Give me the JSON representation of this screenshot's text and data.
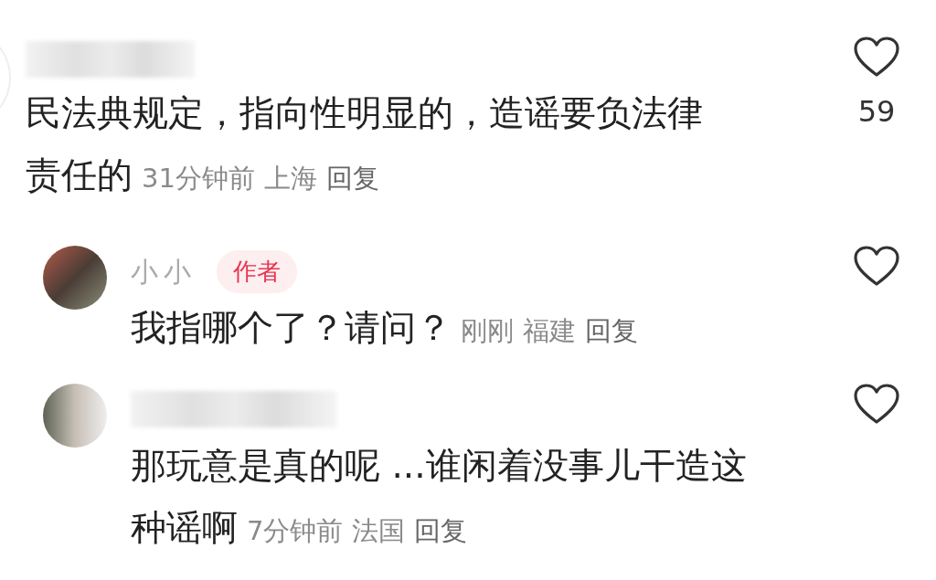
{
  "comments": [
    {
      "text_lines": [
        "民法典规定，指向性明显的，造谣要负法律",
        "责任的"
      ],
      "time": "31分钟前",
      "location": "上海",
      "reply": "回复",
      "likes": "59",
      "replies": [
        {
          "name": "小小",
          "badge": "作者",
          "text_lines": [
            "我指哪个了？请问？"
          ],
          "time": "刚刚",
          "location": "福建",
          "reply": "回复"
        },
        {
          "text_lines": [
            "那玩意是真的呢 ...谁闲着没事儿干造这",
            "种谣啊"
          ],
          "time": "7分钟前",
          "location": "法国",
          "reply": "回复"
        }
      ]
    }
  ]
}
